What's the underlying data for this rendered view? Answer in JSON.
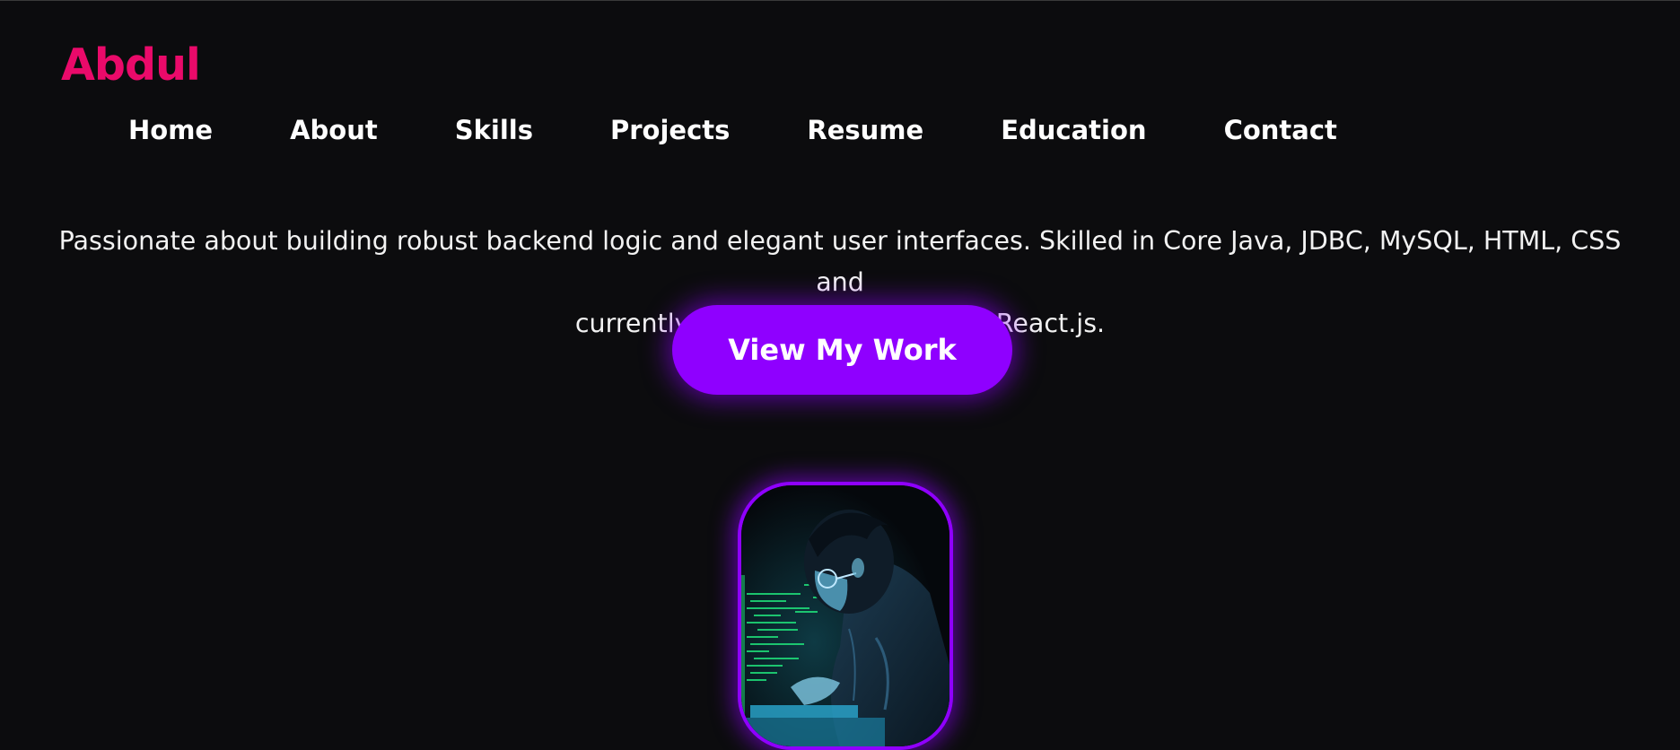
{
  "header": {
    "logo_text": "Abdul",
    "nav": [
      {
        "label": "Home"
      },
      {
        "label": "About"
      },
      {
        "label": "Skills"
      },
      {
        "label": "Projects"
      },
      {
        "label": "Resume"
      },
      {
        "label": "Education"
      },
      {
        "label": "Contact"
      }
    ]
  },
  "hero": {
    "tagline_line1": "Passionate about building robust backend logic and elegant user interfaces. Skilled in Core Java, JDBC, MySQL, HTML, CSS and",
    "tagline_line2": "currently learning Spring Boot & React.js.",
    "cta_label": "View My Work"
  },
  "avatar": {
    "description_icon": "coder-illustration"
  },
  "colors": {
    "background": "#0c0c0e",
    "logo": "#ea0a6a",
    "accent": "#8f00ff",
    "text": "#ffffff"
  }
}
